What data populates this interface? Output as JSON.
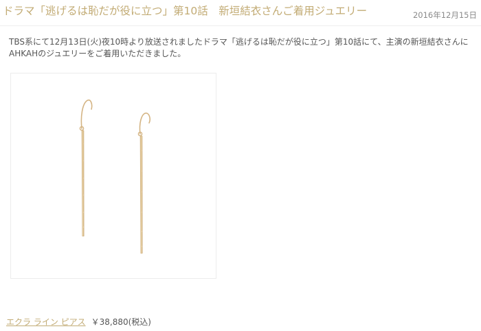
{
  "post": {
    "title": "ドラマ「逃げるは恥だが役に立つ」第10話　新垣結衣さんご着用ジュエリー",
    "date": "2016年12月15日",
    "intro": "TBS系にて12月13日(火)夜10時より放送されましたドラマ「逃げるは恥だが役に立つ」第10話にて、主演の新垣結衣さんにAHKAHのジュエリーをご着用いただきました。"
  },
  "product": {
    "link_label": "エクラ ライン ピアス",
    "price": "￥38,880(税込)",
    "image": "gold-bar-drop-earrings"
  },
  "colors": {
    "accent_gold": "#c2ab74",
    "text": "#555555"
  }
}
